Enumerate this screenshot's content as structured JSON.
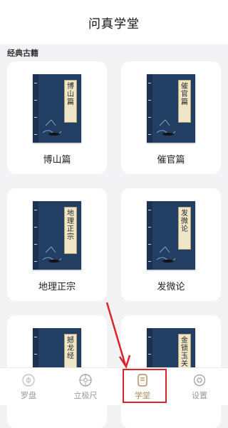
{
  "header": {
    "title": "问真学堂"
  },
  "section": {
    "title": "经典古籍"
  },
  "books": [
    {
      "label": "博山篇",
      "cover_title": [
        "博",
        "山",
        "篇"
      ]
    },
    {
      "label": "催官篇",
      "cover_title": [
        "催",
        "官",
        "篇"
      ]
    },
    {
      "label": "地理正宗",
      "cover_title": [
        "地",
        "理",
        "正",
        "宗"
      ]
    },
    {
      "label": "发微论",
      "cover_title": [
        "发",
        "微",
        "论"
      ]
    },
    {
      "label": "",
      "cover_title": [
        "撼",
        "龙",
        "经"
      ]
    },
    {
      "label": "",
      "cover_title": [
        "金",
        "锁",
        "玉",
        "关"
      ]
    }
  ],
  "tabs": [
    {
      "label": "罗盘",
      "icon": "compass-icon",
      "active": false
    },
    {
      "label": "立极尺",
      "icon": "ruler-dial-icon",
      "active": false
    },
    {
      "label": "学堂",
      "icon": "book-icon",
      "active": true
    },
    {
      "label": "设置",
      "icon": "gear-icon",
      "active": false
    }
  ],
  "colors": {
    "accent": "#b28a58",
    "annotation": "#d9242b",
    "cover": "#223f63"
  }
}
